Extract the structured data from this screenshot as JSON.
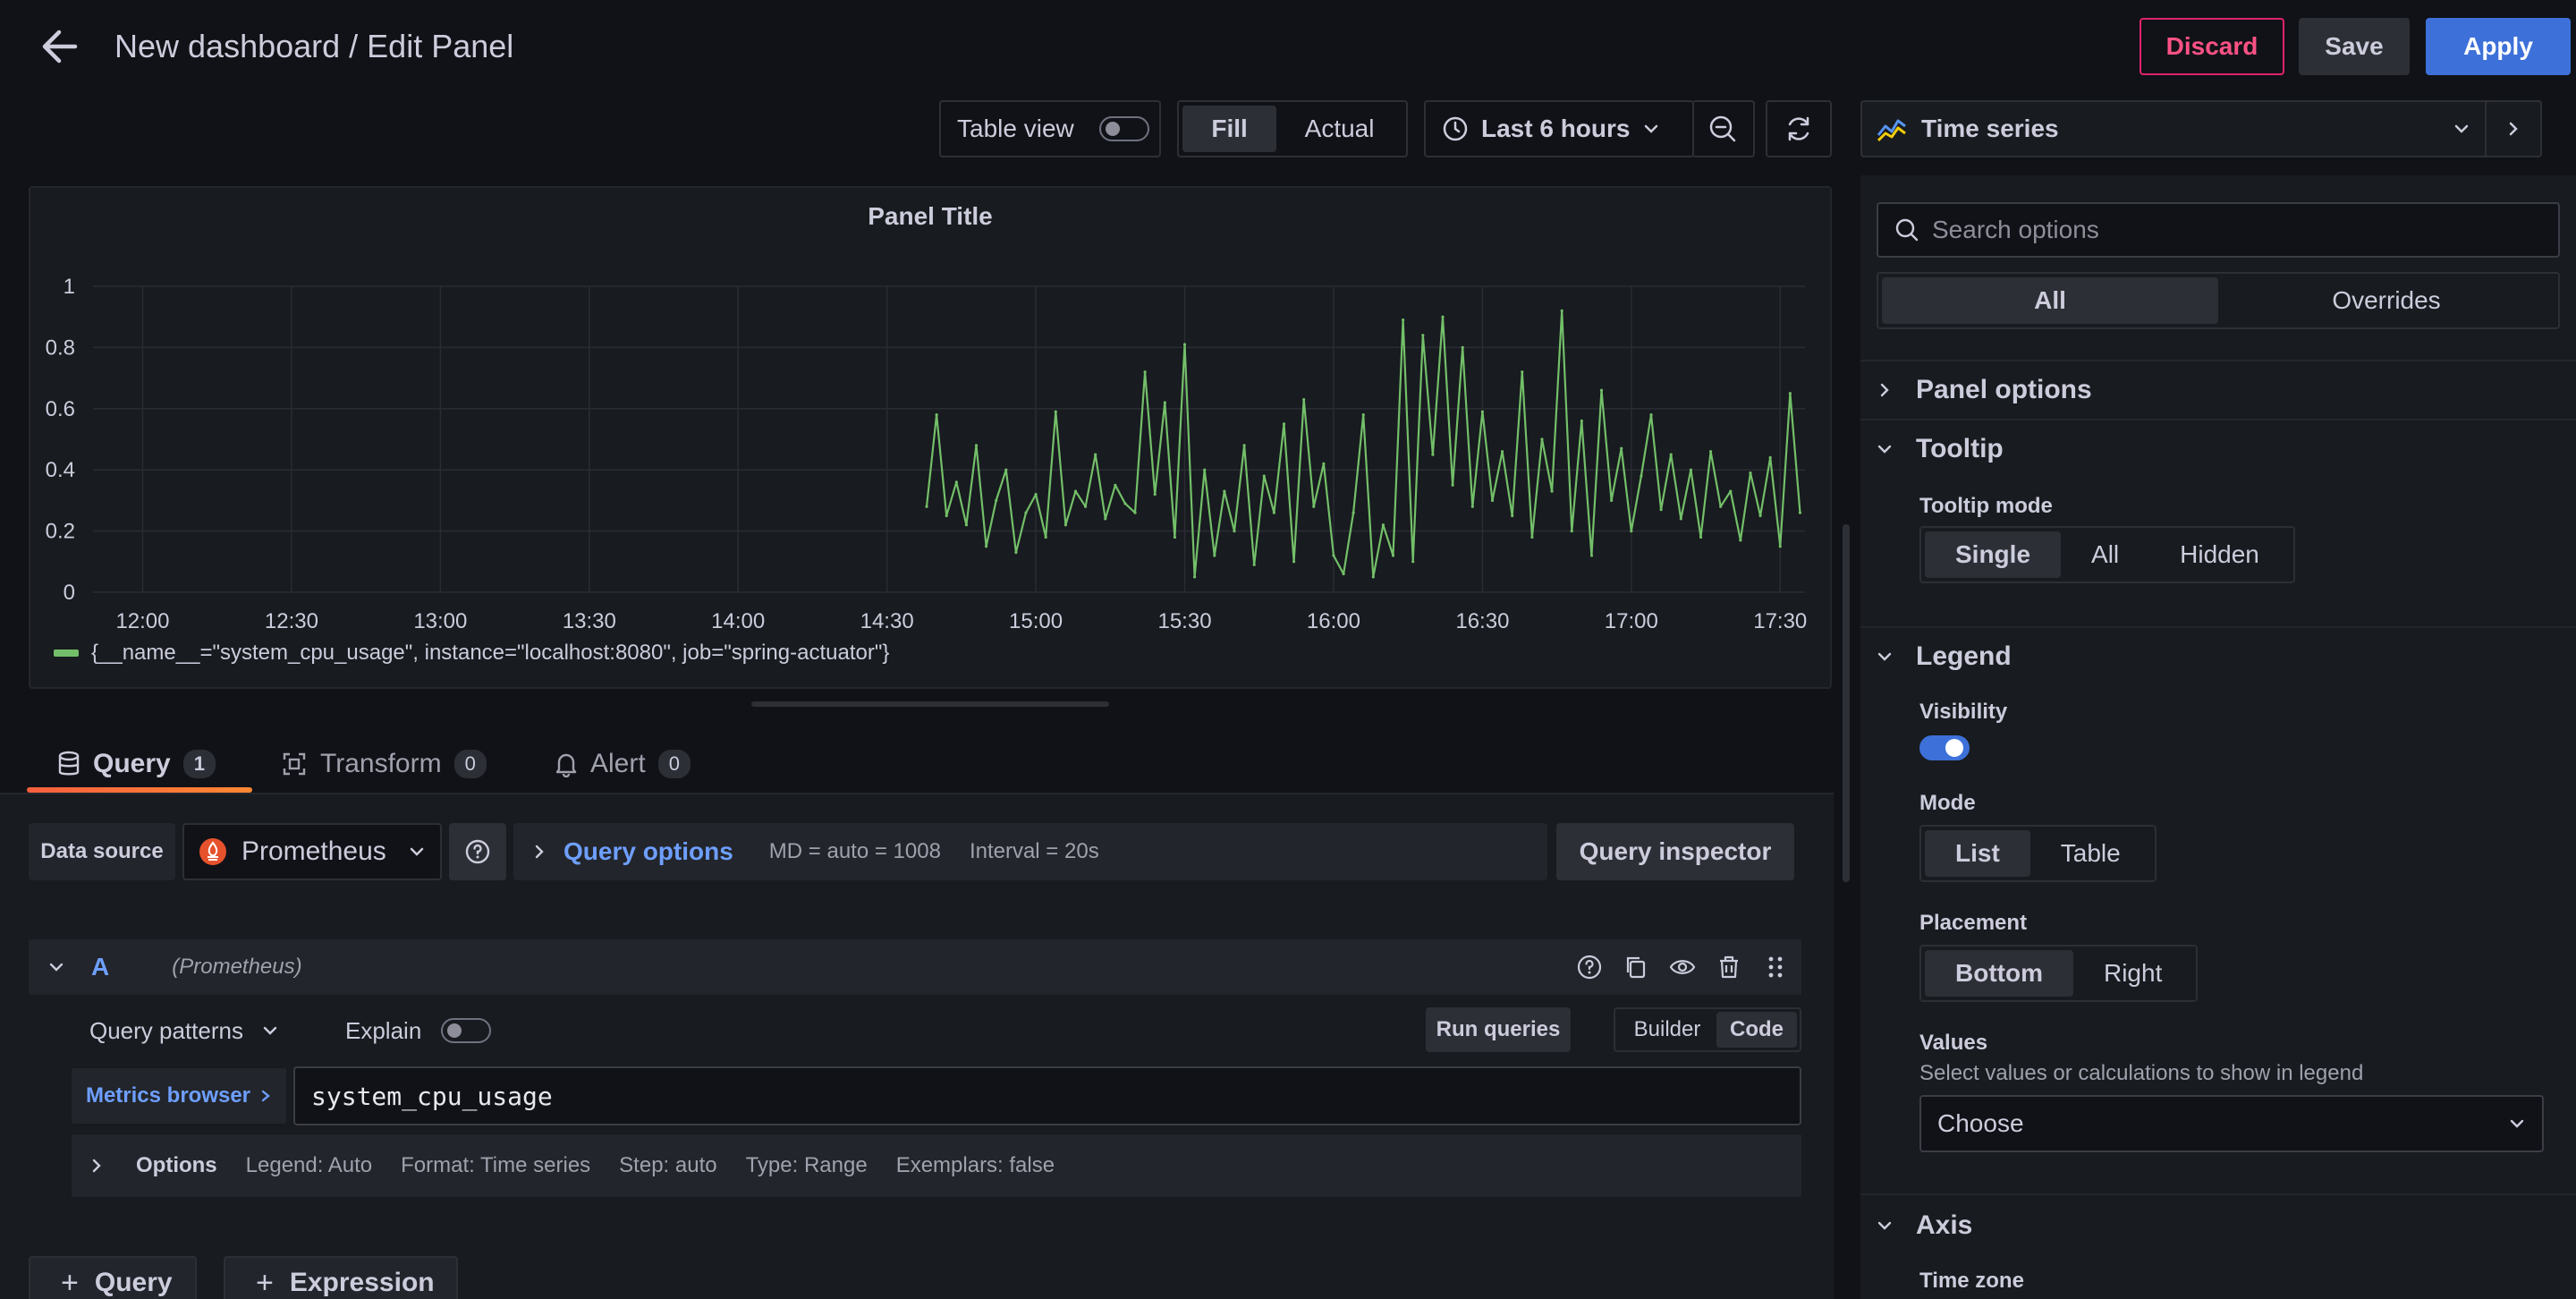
{
  "header": {
    "title": "New dashboard / Edit Panel",
    "discard_label": "Discard",
    "save_label": "Save",
    "apply_label": "Apply"
  },
  "toolbar": {
    "table_view_label": "Table view",
    "table_view_on": false,
    "fill_label": "Fill",
    "actual_label": "Actual",
    "time_range": "Last 6 hours"
  },
  "panel": {
    "title": "Panel Title",
    "legend_label": "{__name__=\"system_cpu_usage\", instance=\"localhost:8080\", job=\"spring-actuator\"}"
  },
  "chart_data": {
    "type": "line",
    "title": "Panel Title",
    "xlabel": "",
    "ylabel": "",
    "x_ticks": [
      "12:00",
      "12:30",
      "13:00",
      "13:30",
      "14:00",
      "14:30",
      "15:00",
      "15:30",
      "16:00",
      "16:30",
      "17:00",
      "17:30"
    ],
    "y_ticks": [
      0,
      0.2,
      0.4,
      0.6,
      0.8,
      1
    ],
    "ylim": [
      0,
      1
    ],
    "xlim": [
      "11:50",
      "17:35"
    ],
    "grid": true,
    "legend_position": "bottom",
    "color": "#73bf69",
    "series": [
      {
        "name": "{__name__=\"system_cpu_usage\", instance=\"localhost:8080\", job=\"spring-actuator\"}",
        "x": [
          "14:38",
          "14:40",
          "14:42",
          "14:44",
          "14:46",
          "14:48",
          "14:50",
          "14:52",
          "14:54",
          "14:56",
          "14:58",
          "15:00",
          "15:02",
          "15:04",
          "15:06",
          "15:08",
          "15:10",
          "15:12",
          "15:14",
          "15:16",
          "15:18",
          "15:20",
          "15:22",
          "15:24",
          "15:26",
          "15:28",
          "15:30",
          "15:32",
          "15:34",
          "15:36",
          "15:38",
          "15:40",
          "15:42",
          "15:44",
          "15:46",
          "15:48",
          "15:50",
          "15:52",
          "15:54",
          "15:56",
          "15:58",
          "16:00",
          "16:02",
          "16:04",
          "16:06",
          "16:08",
          "16:10",
          "16:12",
          "16:14",
          "16:16",
          "16:18",
          "16:20",
          "16:22",
          "16:24",
          "16:26",
          "16:28",
          "16:30",
          "16:32",
          "16:34",
          "16:36",
          "16:38",
          "16:40",
          "16:42",
          "16:44",
          "16:46",
          "16:48",
          "16:50",
          "16:52",
          "16:54",
          "16:56",
          "16:58",
          "17:00",
          "17:02",
          "17:04",
          "17:06",
          "17:08",
          "17:10",
          "17:12",
          "17:14",
          "17:16",
          "17:18",
          "17:20",
          "17:22",
          "17:24",
          "17:26",
          "17:28",
          "17:30",
          "17:32",
          "17:34"
        ],
        "values": [
          0.28,
          0.58,
          0.25,
          0.36,
          0.22,
          0.48,
          0.15,
          0.3,
          0.4,
          0.13,
          0.26,
          0.32,
          0.18,
          0.59,
          0.22,
          0.33,
          0.28,
          0.45,
          0.24,
          0.35,
          0.29,
          0.26,
          0.72,
          0.32,
          0.62,
          0.18,
          0.81,
          0.05,
          0.4,
          0.12,
          0.33,
          0.2,
          0.48,
          0.09,
          0.38,
          0.26,
          0.55,
          0.1,
          0.63,
          0.28,
          0.42,
          0.12,
          0.06,
          0.26,
          0.58,
          0.05,
          0.22,
          0.12,
          0.89,
          0.1,
          0.84,
          0.45,
          0.9,
          0.35,
          0.8,
          0.28,
          0.59,
          0.3,
          0.46,
          0.25,
          0.72,
          0.18,
          0.5,
          0.33,
          0.92,
          0.2,
          0.56,
          0.12,
          0.66,
          0.3,
          0.47,
          0.2,
          0.38,
          0.58,
          0.27,
          0.45,
          0.24,
          0.4,
          0.18,
          0.46,
          0.28,
          0.33,
          0.17,
          0.39,
          0.25,
          0.44,
          0.15,
          0.65,
          0.26
        ]
      }
    ]
  },
  "query_tabs": {
    "query_label": "Query",
    "query_count": "1",
    "transform_label": "Transform",
    "transform_count": "0",
    "alert_label": "Alert",
    "alert_count": "0"
  },
  "datasource": {
    "label": "Data source",
    "name": "Prometheus"
  },
  "query_options": {
    "title": "Query options",
    "md": "MD = auto = 1008",
    "interval": "Interval = 20s",
    "inspector_label": "Query inspector"
  },
  "query": {
    "ref_id": "A",
    "datasource_name": "(Prometheus)",
    "patterns_label": "Query patterns",
    "explain_label": "Explain",
    "explain_on": false,
    "run_label": "Run queries",
    "builder_label": "Builder",
    "code_label": "Code",
    "metrics_browser_label": "Metrics browser",
    "expression": "system_cpu_usage",
    "options_label": "Options",
    "legend": "Legend: Auto",
    "format": "Format: Time series",
    "step": "Step: auto",
    "type": "Type: Range",
    "exemplars": "Exemplars: false"
  },
  "add_buttons": {
    "query_label": "Query",
    "expression_label": "Expression"
  },
  "options_pane": {
    "viz_name": "Time series",
    "search_placeholder": "Search options",
    "all_label": "All",
    "overrides_label": "Overrides",
    "panel_options_label": "Panel options",
    "tooltip_label": "Tooltip",
    "tooltip_mode_label": "Tooltip mode",
    "tooltip_modes": [
      "Single",
      "All",
      "Hidden"
    ],
    "legend_label": "Legend",
    "visibility_label": "Visibility",
    "visibility_on": true,
    "mode_label": "Mode",
    "modes": [
      "List",
      "Table"
    ],
    "placement_label": "Placement",
    "placements": [
      "Bottom",
      "Right"
    ],
    "values_label": "Values",
    "values_desc": "Select values or calculations to show in legend",
    "values_placeholder": "Choose",
    "axis_label": "Axis",
    "time_zone_label": "Time zone"
  }
}
